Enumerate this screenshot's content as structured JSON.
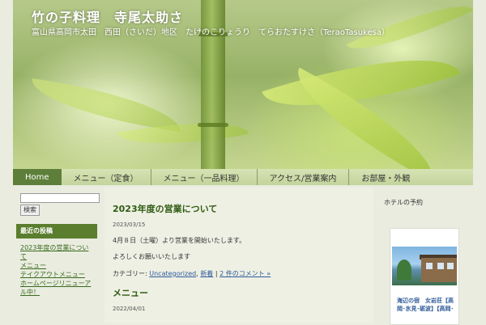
{
  "site": {
    "title": "竹の子料理　寺尾太助さ",
    "description": "富山県高岡市太田　西田（さいだ）地区　たけのこりょうり　てらおたすけさ（TeraoTasukesa）"
  },
  "nav": {
    "items": [
      {
        "label": "Home",
        "active": true
      },
      {
        "label": "メニュー（定食）",
        "active": false
      },
      {
        "label": "メニュー（一品料理）",
        "active": false
      },
      {
        "label": "アクセス/営業案内",
        "active": false
      },
      {
        "label": "お部屋・外観",
        "active": false
      }
    ]
  },
  "sidebar_left": {
    "search": {
      "placeholder": "",
      "button_label": "検索"
    },
    "recent": {
      "heading": "最近の投稿",
      "items": [
        "2023年度の営業について",
        "メニュー",
        "テイクアウトメニュー",
        "ホームページリニューアル中！"
      ]
    }
  },
  "posts": [
    {
      "title": "2023年度の営業について",
      "date": "2023/03/15",
      "paragraphs": [
        "4月８日（土曜）より営業を開始いたします。",
        "よろしくお願いいたします"
      ],
      "meta": {
        "prefix": "カテゴリー:",
        "category": "Uncategorized",
        "sep1": ",",
        "tag": "新着",
        "sep2": "|",
        "comments": "2 件のコメント »"
      }
    },
    {
      "title": "メニュー",
      "date": "2022/04/01"
    }
  ],
  "sidebar_right": {
    "title": "ホテルの予約",
    "hotel": {
      "name": "海辺の宿　女岩荘【高岡･氷見･砺波】【高岡･"
    }
  },
  "colors": {
    "nav_active": "#5e7f3a",
    "widget_heading": "#5b7d2e",
    "post_title": "#2f5b12",
    "link": "#2f5b9a"
  }
}
